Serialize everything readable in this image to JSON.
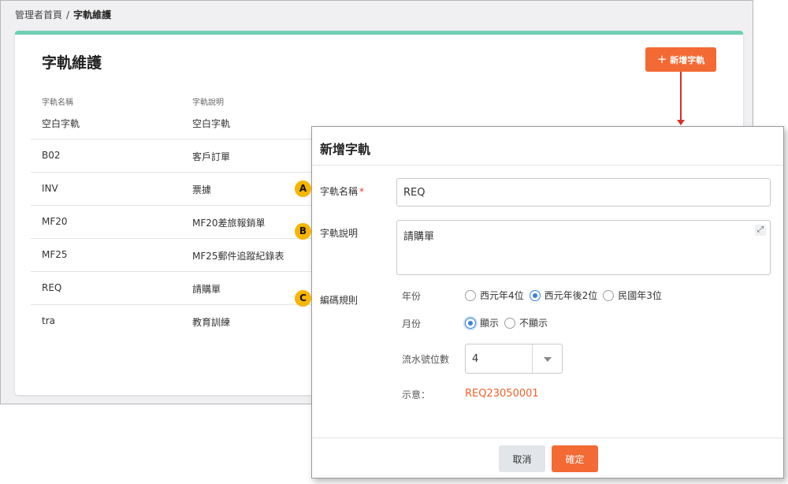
{
  "breadcrumb": {
    "home": "管理者首頁",
    "separator": "/",
    "current": "字軌維護"
  },
  "page": {
    "title": "字軌維護",
    "add_button": "新增字軌"
  },
  "table": {
    "headers": [
      "字軌名稱",
      "字軌說明"
    ],
    "rows": [
      [
        "空白字軌",
        "空白字軌"
      ],
      [
        "B02",
        "客戶訂單"
      ],
      [
        "INV",
        "票據"
      ],
      [
        "MF20",
        "MF20差旅報銷單"
      ],
      [
        "MF25",
        "MF25郵件追蹤紀錄表"
      ],
      [
        "REQ",
        "請購單"
      ],
      [
        "tra",
        "教育訓練"
      ]
    ]
  },
  "modal": {
    "title": "新增字軌",
    "name_label": "字軌名稱",
    "required_mark": "*",
    "name_value": "REQ",
    "desc_label": "字軌說明",
    "desc_value": "請購單",
    "rule_label": "編碼規則",
    "year_label": "年份",
    "year_options": [
      "西元年4位",
      "西元年後2位",
      "民國年3位"
    ],
    "year_selected": "西元年後2位",
    "month_label": "月份",
    "month_options": [
      "顯示",
      "不顯示"
    ],
    "month_selected": "顯示",
    "serial_label": "流水號位數",
    "serial_value": "4",
    "preview_label": "示意：",
    "preview_value": "REQ23050001",
    "cancel_label": "取消",
    "confirm_label": "確定"
  },
  "markers": {
    "a": "A",
    "b": "B",
    "c": "C"
  },
  "colors": {
    "accent": "#f36a35",
    "card_top": "#6ecfb4",
    "marker": "#f7b500",
    "radio_active": "#3b82e0",
    "arrow": "#d9302c"
  },
  "icons": [
    "plus-icon",
    "expand-icon",
    "chevron-down-icon"
  ]
}
